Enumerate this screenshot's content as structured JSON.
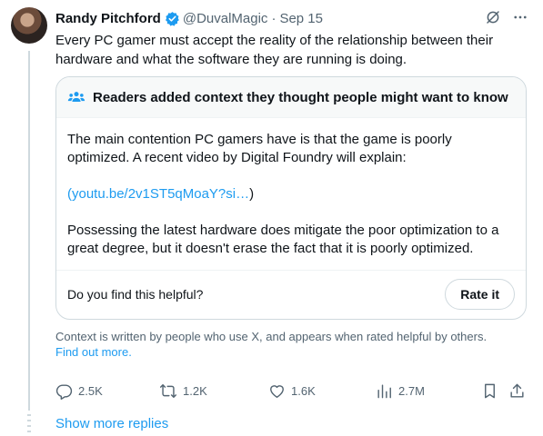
{
  "tweet": {
    "author_name": "Randy Pitchford",
    "handle": "@DuvalMagic",
    "separator": "·",
    "date": "Sep 15",
    "text": "Every PC gamer must accept the reality of the relationship between their hardware and what the software they are running is doing."
  },
  "note": {
    "header": "Readers added context they thought people might want to know",
    "para1": "The main contention PC gamers have is that the game is poorly optimized.  A recent video by Digital Foundry will explain:",
    "link_open": "(",
    "link_text": "youtu.be/2v1ST5qMoaY?si…",
    "link_close": ")",
    "para2": "Possessing the latest hardware does mitigate the poor optimization to a great degree, but it doesn't erase the fact that it is poorly optimized.",
    "helpful_question": "Do you find this helpful?",
    "rate_button": "Rate it"
  },
  "context": {
    "text": "Context is written by people who use X, and appears when rated helpful by others.",
    "learn_more": "Find out more."
  },
  "actions": {
    "replies": "2.5K",
    "reposts": "1.2K",
    "likes": "1.6K",
    "views": "2.7M"
  },
  "show_more_replies": "Show more replies",
  "colors": {
    "accent": "#1d9bf0",
    "secondary_text": "#536471",
    "border": "#cfd9de",
    "verified": "#1d9bf0"
  },
  "icons": [
    "verified-badge-icon",
    "grok-icon",
    "more-icon",
    "community-notes-icon",
    "reply-icon",
    "repost-icon",
    "like-icon",
    "views-icon",
    "bookmark-icon",
    "share-icon"
  ]
}
